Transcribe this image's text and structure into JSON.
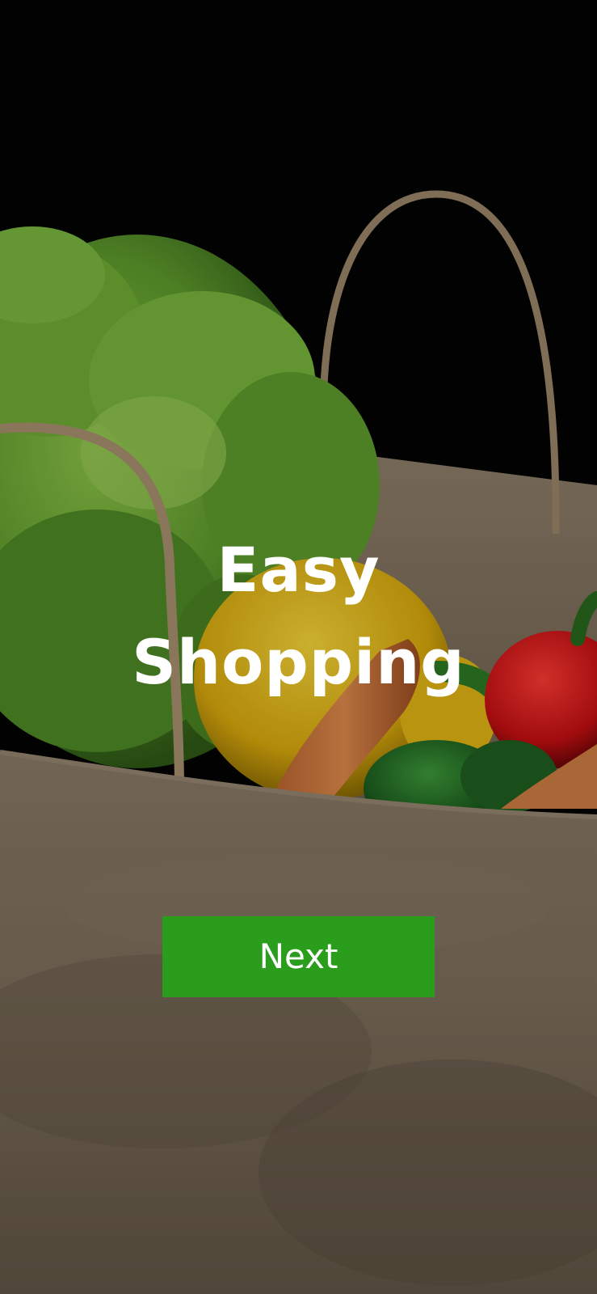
{
  "onboarding": {
    "title_line1": "Easy",
    "title_line2": "Shopping",
    "next_label": "Next"
  },
  "colors": {
    "button_bg": "#2a9e1c",
    "button_text": "#ffffff",
    "title_text": "#ffffff"
  },
  "background": {
    "subject": "paper-grocery-bag-with-vegetables"
  }
}
